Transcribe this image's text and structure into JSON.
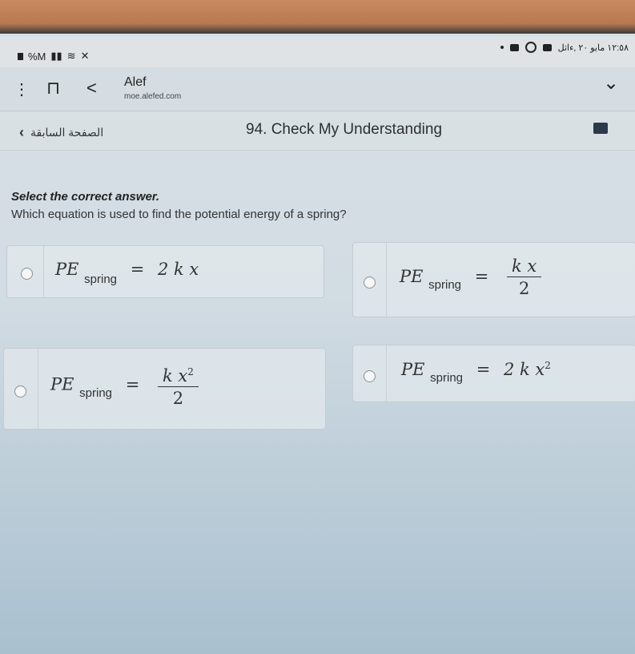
{
  "status_bar": {
    "left_text": "%M",
    "right_text": "١٢:٥٨ مايو ٢٠ ,ءاثل"
  },
  "browser": {
    "title": "Alef",
    "url": "moe.alefed.com"
  },
  "nav": {
    "back_label": "الصفحة السابقة",
    "page_title": "94. Check My Understanding"
  },
  "question": {
    "instruction": "Select the correct answer.",
    "text": "Which equation is used to find the potential energy of a spring?"
  },
  "options": [
    {
      "lhs": "PE",
      "sub": "spring",
      "eq": "=",
      "rhs": "2 k x"
    },
    {
      "lhs": "PE",
      "sub": "spring",
      "eq": "=",
      "num": "k x",
      "den": "2"
    },
    {
      "lhs": "PE",
      "sub": "spring",
      "eq": "=",
      "num": "k x",
      "num_exp": "2",
      "den": "2"
    },
    {
      "lhs": "PE",
      "sub": "spring",
      "eq": "=",
      "rhs": "2 k x",
      "rhs_exp": "2"
    }
  ],
  "colors": {
    "background": "#d2dce3",
    "nav_square": "#2a3a4c"
  }
}
